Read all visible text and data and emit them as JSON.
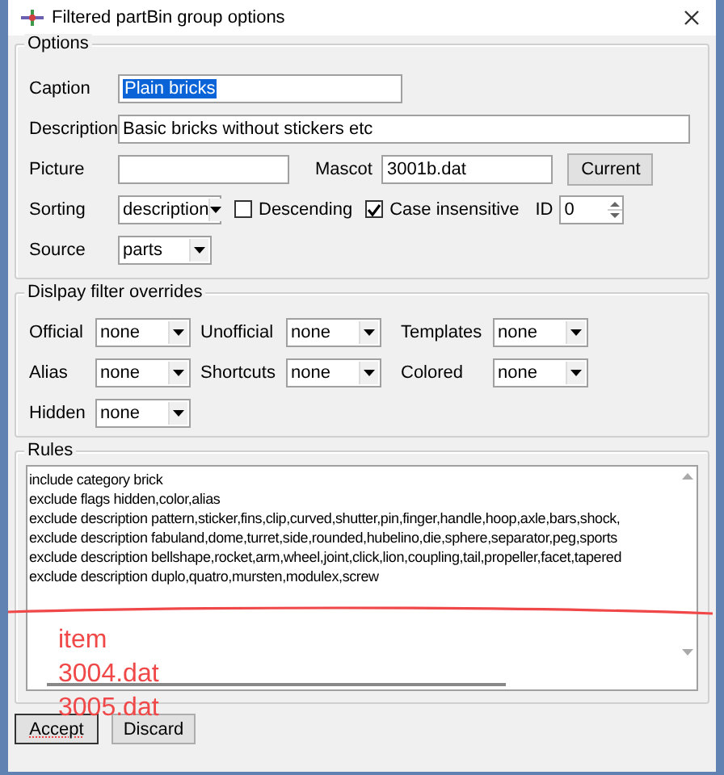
{
  "window": {
    "title": "Filtered partBin group options"
  },
  "options": {
    "title": "Options",
    "caption": {
      "label": "Caption",
      "value": "Plain bricks",
      "text_selected": true
    },
    "description": {
      "label": "Description",
      "value": "Basic bricks without stickers etc"
    },
    "picture": {
      "label": "Picture"
    },
    "mascot": {
      "label": "Mascot",
      "value": "3001b.dat"
    },
    "current_button": "Current",
    "sorting": {
      "label": "Sorting",
      "value": "description"
    },
    "checks": [
      {
        "label": "Descending",
        "checked": false
      },
      {
        "label": "Case insensitive",
        "checked": true
      }
    ],
    "id": {
      "label": "ID",
      "value": "0"
    },
    "source": {
      "label": "Source",
      "value": "parts"
    }
  },
  "overrides": {
    "title": "Dislpay filter overrides",
    "items": [
      {
        "label": "Official",
        "value": "none"
      },
      {
        "label": "Unofficial",
        "value": "none"
      },
      {
        "label": "Templates",
        "value": "none"
      },
      {
        "label": "Alias",
        "value": "none"
      },
      {
        "label": "Shortcuts",
        "value": "none"
      },
      {
        "label": "Colored",
        "value": "none"
      },
      {
        "label": "Hidden",
        "value": "none"
      }
    ]
  },
  "rules": {
    "title": "Rules",
    "lines": [
      "include category brick",
      "exclude flags hidden,color,alias",
      "exclude description pattern,sticker,fins,clip,curved,shutter,pin,finger,handle,hoop,axle,bars,shock,",
      "exclude description fabuland,dome,turret,side,rounded,hubelino,die,sphere,separator,peg,sports",
      "exclude description bellshape,rocket,arm,wheel,joint,click,lion,coupling,tail,propeller,facet,tapered",
      "exclude description duplo,quatro,mursten,modulex,screw"
    ]
  },
  "annotations": [
    "item",
    "3004.dat",
    "3005.dat"
  ],
  "buttons": [
    {
      "label": "Accept",
      "default": true
    },
    {
      "label": "Discard",
      "default": false
    }
  ]
}
